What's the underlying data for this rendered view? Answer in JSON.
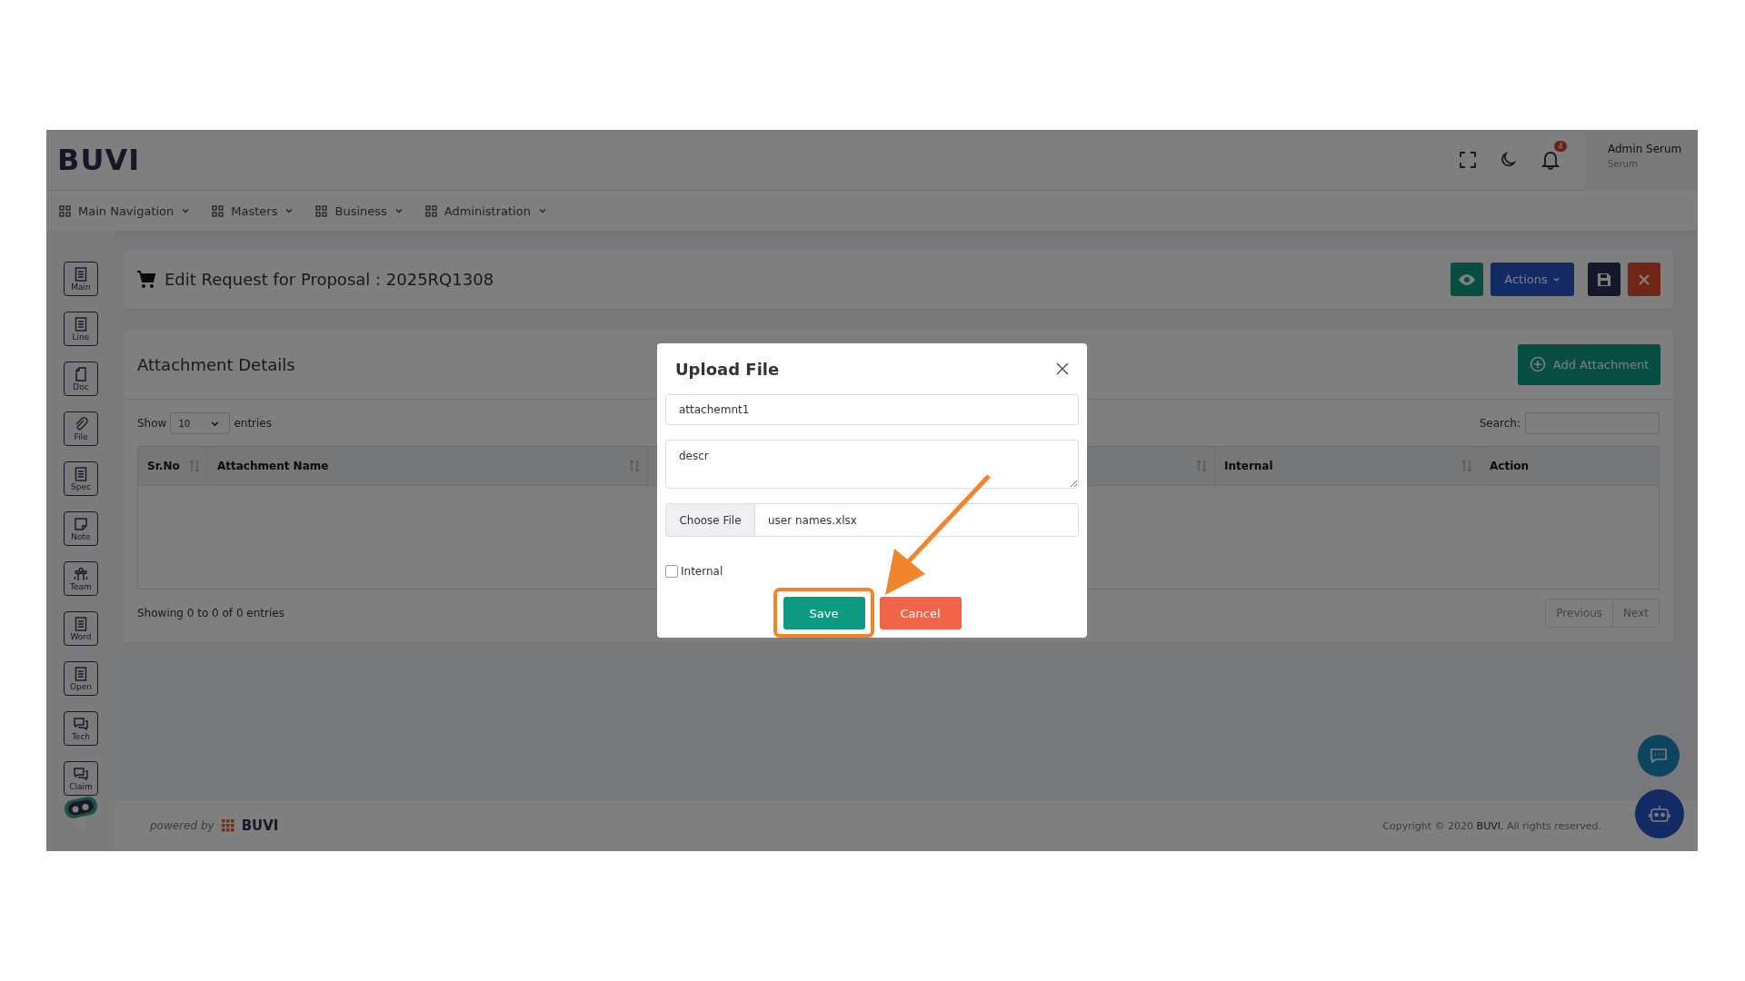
{
  "header": {
    "logo": "BUVI",
    "notification_count": "4",
    "user_name": "Admin Serum",
    "user_role": "Serum"
  },
  "nav": [
    {
      "label": "Main Navigation"
    },
    {
      "label": "Masters"
    },
    {
      "label": "Business"
    },
    {
      "label": "Administration"
    }
  ],
  "sidebar": [
    {
      "label": "Main",
      "kind": "list"
    },
    {
      "label": "Line",
      "kind": "list"
    },
    {
      "label": "Doc",
      "kind": "doc"
    },
    {
      "label": "File",
      "kind": "clip"
    },
    {
      "label": "Spec",
      "kind": "list"
    },
    {
      "label": "Note",
      "kind": "note"
    },
    {
      "label": "Team",
      "kind": "team"
    },
    {
      "label": "Word",
      "kind": "list"
    },
    {
      "label": "Open",
      "kind": "list"
    },
    {
      "label": "Tech",
      "kind": "chat"
    },
    {
      "label": "Claim",
      "kind": "chat"
    }
  ],
  "page": {
    "title": "Edit Request for Proposal : 2025RQ1308",
    "actions_label": "Actions"
  },
  "attachments": {
    "title": "Attachment Details",
    "add_label": "Add Attachment",
    "show_label": "Show",
    "page_size": "10",
    "entries_label": "entries",
    "search_label": "Search:",
    "columns": [
      {
        "kind": "label",
        "label": "Sr.No",
        "sortable": true
      },
      {
        "kind": "label",
        "label": "Attachment Name",
        "sortable": true
      },
      {
        "kind": "covered",
        "sortable": true
      },
      {
        "kind": "label",
        "label": "Internal",
        "sortable": true
      },
      {
        "kind": "label",
        "label": "Action",
        "sortable": false
      }
    ],
    "info": "Showing 0 to 0 of 0 entries",
    "pager": [
      "Previous",
      "Next"
    ]
  },
  "dialog": {
    "title": "Upload File",
    "name_value": "attachemnt1",
    "description_value": "descr",
    "file_button": "Choose File",
    "file_name": "user names.xlsx",
    "internal_label": "Internal",
    "internal_checked": false,
    "save_label": "Save",
    "cancel_label": "Cancel"
  },
  "footer": {
    "powered_by": "powered by",
    "brand": "BUVI",
    "copyright": "Copyright © 2020 **BUVI.** All rights reserved."
  }
}
